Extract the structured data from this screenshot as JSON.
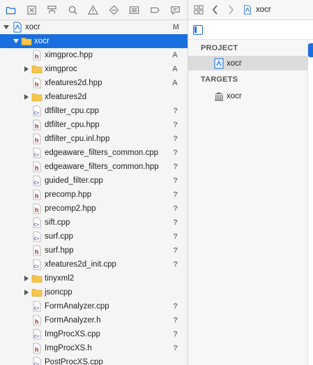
{
  "navigator": {
    "toolbar_icons": [
      "folder-icon",
      "warning-box-icon",
      "hierarchy-icon",
      "search-icon",
      "issue-warning-icon",
      "test-diamond-icon",
      "debug-list-icon",
      "breakpoint-tag-icon",
      "report-bubble-icon"
    ],
    "root": {
      "name": "xocr",
      "status": "M"
    },
    "items": [
      {
        "name": "xocr",
        "kind": "folder",
        "depth": 1,
        "expanded": true,
        "selected": true,
        "status": ""
      },
      {
        "name": "ximgproc.hpp",
        "kind": "h",
        "depth": 2,
        "status": "A"
      },
      {
        "name": "ximgproc",
        "kind": "folder",
        "depth": 2,
        "expanded": false,
        "status": "A"
      },
      {
        "name": "xfeatures2d.hpp",
        "kind": "h",
        "depth": 2,
        "status": "A"
      },
      {
        "name": "xfeatures2d",
        "kind": "folder",
        "depth": 2,
        "expanded": false,
        "status": ""
      },
      {
        "name": "dtfilter_cpu.cpp",
        "kind": "cpp",
        "depth": 2,
        "status": "?"
      },
      {
        "name": "dtfilter_cpu.hpp",
        "kind": "h",
        "depth": 2,
        "status": "?"
      },
      {
        "name": "dtfilter_cpu.inl.hpp",
        "kind": "h",
        "depth": 2,
        "status": "?"
      },
      {
        "name": "edgeaware_filters_common.cpp",
        "kind": "cpp",
        "depth": 2,
        "status": "?"
      },
      {
        "name": "edgeaware_filters_common.hpp",
        "kind": "h",
        "depth": 2,
        "status": "?"
      },
      {
        "name": "guided_filter.cpp",
        "kind": "cpp",
        "depth": 2,
        "status": "?"
      },
      {
        "name": "precomp.hpp",
        "kind": "h",
        "depth": 2,
        "status": "?"
      },
      {
        "name": "precomp2.hpp",
        "kind": "h",
        "depth": 2,
        "status": "?"
      },
      {
        "name": "sift.cpp",
        "kind": "cpp",
        "depth": 2,
        "status": "?"
      },
      {
        "name": "surf.cpp",
        "kind": "cpp",
        "depth": 2,
        "status": "?"
      },
      {
        "name": "surf.hpp",
        "kind": "h",
        "depth": 2,
        "status": "?"
      },
      {
        "name": "xfeatures2d_init.cpp",
        "kind": "cpp",
        "depth": 2,
        "status": "?"
      },
      {
        "name": "tinyxml2",
        "kind": "folder",
        "depth": 2,
        "expanded": false,
        "status": ""
      },
      {
        "name": "jsoncpp",
        "kind": "folder",
        "depth": 2,
        "expanded": false,
        "status": ""
      },
      {
        "name": "FormAnalyzer.cpp",
        "kind": "cpp",
        "depth": 2,
        "status": "?"
      },
      {
        "name": "FormAnalyzer.h",
        "kind": "h",
        "depth": 2,
        "status": "?"
      },
      {
        "name": "ImgProcXS.cpp",
        "kind": "cpp",
        "depth": 2,
        "status": "?"
      },
      {
        "name": "ImgProcXS.h",
        "kind": "h",
        "depth": 2,
        "status": "?"
      },
      {
        "name": "PostProcXS.cpp",
        "kind": "cpp",
        "depth": 2,
        "status": ""
      }
    ]
  },
  "editor": {
    "jump_bar": {
      "title": "xocr"
    },
    "project_section": "PROJECT",
    "project_item": "xocr",
    "targets_section": "TARGETS",
    "target_item": "xocr"
  },
  "colors": {
    "selection": "#1a6fe0",
    "folder": "#f7c64a",
    "header_icon": "#9b2a28",
    "cpp_icon": "#5b5ea6"
  }
}
